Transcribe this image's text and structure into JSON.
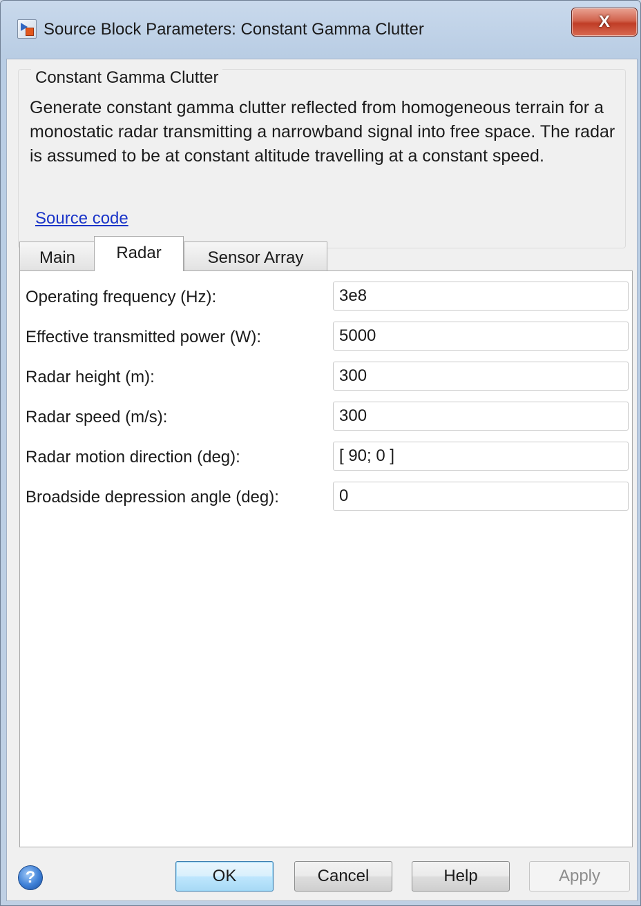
{
  "window": {
    "title": "Source Block Parameters: Constant Gamma Clutter",
    "close_label": "X"
  },
  "block": {
    "group_title": "Constant Gamma Clutter",
    "description": "Generate constant gamma clutter reflected from homogeneous terrain for a monostatic radar transmitting a narrowband signal into free space. The radar is assumed to be at constant altitude travelling at a constant speed.",
    "source_link": "Source code"
  },
  "tabs": [
    {
      "label": "Main",
      "active": false
    },
    {
      "label": "Radar",
      "active": true
    },
    {
      "label": "Sensor Array",
      "active": false
    }
  ],
  "params": [
    {
      "label": "Operating frequency (Hz):",
      "value": "3e8"
    },
    {
      "label": "Effective transmitted power (W):",
      "value": "5000"
    },
    {
      "label": "Radar height (m):",
      "value": "300"
    },
    {
      "label": "Radar speed (m/s):",
      "value": "300"
    },
    {
      "label": "Radar motion direction (deg):",
      "value": "[ 90; 0 ]"
    },
    {
      "label": "Broadside depression angle (deg):",
      "value": "0"
    }
  ],
  "footer": {
    "help_icon": "question-mark-icon",
    "help_icon_glyph": "?",
    "ok": "OK",
    "cancel": "Cancel",
    "help": "Help",
    "apply": "Apply",
    "apply_enabled": false
  },
  "colors": {
    "link": "#1a34c8",
    "close": "#c03d26",
    "default_button": "#bee6fd"
  }
}
